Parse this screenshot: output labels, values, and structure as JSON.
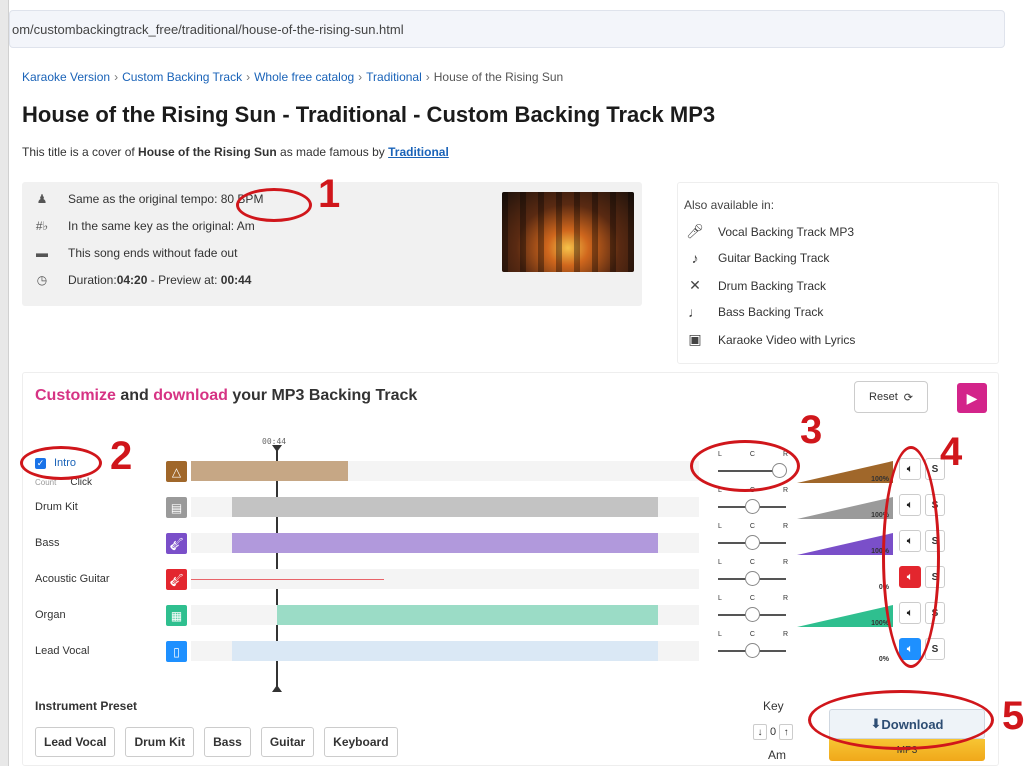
{
  "browser": {
    "url": "om/custombackingtrack_free/traditional/house-of-the-rising-sun.html"
  },
  "breadcrumb": {
    "items": [
      "Karaoke Version",
      "Custom Backing Track",
      "Whole free catalog",
      "Traditional"
    ],
    "current": "House of the Rising Sun",
    "separator": "›"
  },
  "page": {
    "title": "House of the Rising Sun - Traditional - Custom Backing Track MP3",
    "subtitle_pre": "This title is a cover of ",
    "subtitle_song": "House of the Rising Sun",
    "subtitle_mid": " as made famous by ",
    "subtitle_artist": "Traditional"
  },
  "info": {
    "tempo": "Same as the original tempo: 80 BPM",
    "key": "In the same key as the original: Am",
    "fade": "This song ends without fade out",
    "duration_label": "Duration: ",
    "duration": "04:20",
    "preview_label": " - Preview at: ",
    "preview": "00:44"
  },
  "also_available": {
    "heading": "Also available in:",
    "items": [
      "Vocal Backing Track MP3",
      "Guitar Backing Track",
      "Drum Backing Track",
      "Bass Backing Track",
      "Karaoke Video with Lyrics"
    ]
  },
  "mixer": {
    "title_a": "Customize",
    "title_b": " and ",
    "title_c": "download",
    "title_d": " your MP3 Backing Track",
    "reset_label": "Reset",
    "timecode": "00:44",
    "intro_label": "Intro",
    "count_a": "Count",
    "count_b": "Click",
    "pan_l": "L",
    "pan_c": "C",
    "pan_r": "R",
    "solo_label": "S",
    "tracks": [
      {
        "name": "",
        "volume": "100%",
        "color": "#a0672a",
        "pan": 1.0,
        "muted": false
      },
      {
        "name": "Drum Kit",
        "volume": "100%",
        "color": "#9a9a9a",
        "pan": 0.5,
        "muted": false
      },
      {
        "name": "Bass",
        "volume": "100%",
        "color": "#7a4fc9",
        "pan": 0.5,
        "muted": false
      },
      {
        "name": "Acoustic Guitar",
        "volume": "0%",
        "color": "#e3262e",
        "pan": 0.5,
        "muted": true
      },
      {
        "name": "Organ",
        "volume": "100%",
        "color": "#2fbf8f",
        "pan": 0.5,
        "muted": false
      },
      {
        "name": "Lead Vocal",
        "volume": "0%",
        "color": "#1e90ff",
        "pan": 0.5,
        "muted": true
      }
    ]
  },
  "preset": {
    "label": "Instrument Preset",
    "buttons": [
      "Lead Vocal",
      "Drum Kit",
      "Bass",
      "Guitar",
      "Keyboard"
    ]
  },
  "key": {
    "label": "Key",
    "value": "0",
    "name": "Am",
    "down": "↓",
    "up": "↑"
  },
  "download": {
    "label": "Download",
    "format": "MP3"
  },
  "annotations": [
    "1",
    "2",
    "3",
    "4",
    "5"
  ],
  "colors": {
    "accent_pink": "#d63384",
    "link_blue": "#1a63b8",
    "annotation_red": "#d0161b",
    "download_yellow": "#f0a81a"
  }
}
